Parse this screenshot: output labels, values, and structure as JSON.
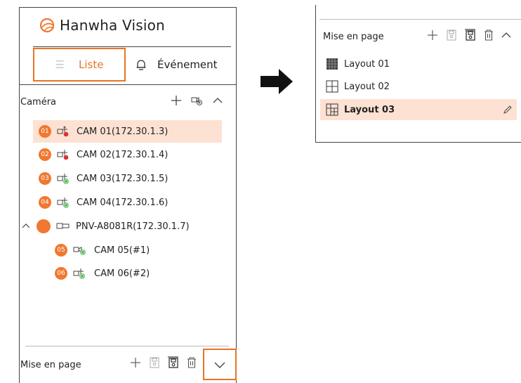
{
  "brand": {
    "name": "Hanwha Vision",
    "mark_color": "#f07830"
  },
  "tabs": {
    "list_label": "Liste",
    "event_label": "Événement"
  },
  "camera_section": {
    "title": "Caméra"
  },
  "cameras": [
    {
      "badge": "01",
      "label": "CAM 01(172.30.1.3)",
      "status": "red",
      "highlighted": true
    },
    {
      "badge": "02",
      "label": "CAM 02(172.30.1.4)",
      "status": "red"
    },
    {
      "badge": "03",
      "label": "CAM 03(172.30.1.5)",
      "status": "green"
    },
    {
      "badge": "04",
      "label": "CAM 04(172.30.1.6)",
      "status": "green"
    }
  ],
  "nvr": {
    "label": "PNV-A8081R(172.30.1.7)"
  },
  "sub_cameras": [
    {
      "badge": "05",
      "label": "CAM 05(#1)",
      "status": "green"
    },
    {
      "badge": "06",
      "label": "CAM 06(#2)",
      "status": "green"
    }
  ],
  "layout_section": {
    "title": "Mise en page"
  },
  "layouts": [
    {
      "label": "Layout 01",
      "icon": "grid-filled-icon"
    },
    {
      "label": "Layout 02",
      "icon": "grid-2x2-icon"
    },
    {
      "label": "Layout 03",
      "icon": "grid-custom-icon",
      "selected": true
    }
  ],
  "colors": {
    "accent": "#e87424",
    "highlight": "#fde1d3",
    "badge": "#f07830",
    "status_red": "#e03030",
    "status_green": "#5cb85c"
  }
}
